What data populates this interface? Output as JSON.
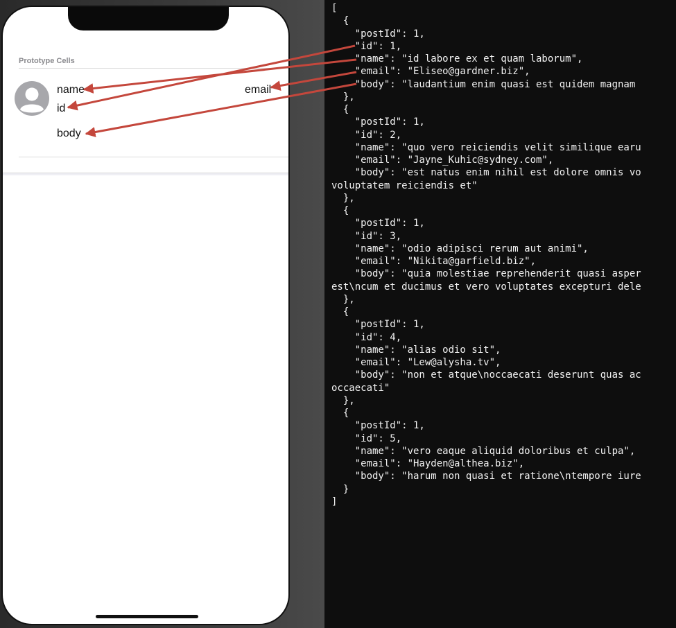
{
  "storyboard": {
    "section_header": "Prototype Cells",
    "cell": {
      "name_label": "name",
      "id_label": "id",
      "email_label": "email",
      "body_label": "body"
    },
    "avatar_icon": "person-circle-icon"
  },
  "json_output": {
    "lines": [
      "[",
      "  {",
      "    \"postId\": 1,",
      "    \"id\": 1,",
      "    \"name\": \"id labore ex et quam laborum\",",
      "    \"email\": \"Eliseo@gardner.biz\",",
      "    \"body\": \"laudantium enim quasi est quidem magnam",
      "  },",
      "  {",
      "    \"postId\": 1,",
      "    \"id\": 2,",
      "    \"name\": \"quo vero reiciendis velit similique earu",
      "    \"email\": \"Jayne_Kuhic@sydney.com\",",
      "    \"body\": \"est natus enim nihil est dolore omnis vo",
      "voluptatem reiciendis et\"",
      "  },",
      "  {",
      "    \"postId\": 1,",
      "    \"id\": 3,",
      "    \"name\": \"odio adipisci rerum aut animi\",",
      "    \"email\": \"Nikita@garfield.biz\",",
      "    \"body\": \"quia molestiae reprehenderit quasi asper",
      "est\\ncum et ducimus et vero voluptates excepturi dele",
      "  },",
      "  {",
      "    \"postId\": 1,",
      "    \"id\": 4,",
      "    \"name\": \"alias odio sit\",",
      "    \"email\": \"Lew@alysha.tv\",",
      "    \"body\": \"non et atque\\noccaecati deserunt quas ac",
      "occaecati\"",
      "  },",
      "  {",
      "    \"postId\": 1,",
      "    \"id\": 5,",
      "    \"name\": \"vero eaque aliquid doloribus et culpa\",",
      "    \"email\": \"Hayden@althea.biz\",",
      "    \"body\": \"harum non quasi et ratione\\ntempore iure",
      "  }",
      "]"
    ]
  },
  "colors": {
    "arrow": "#c4473c",
    "code_background": "#0e0e0e",
    "code_text": "#f2f2f2"
  }
}
